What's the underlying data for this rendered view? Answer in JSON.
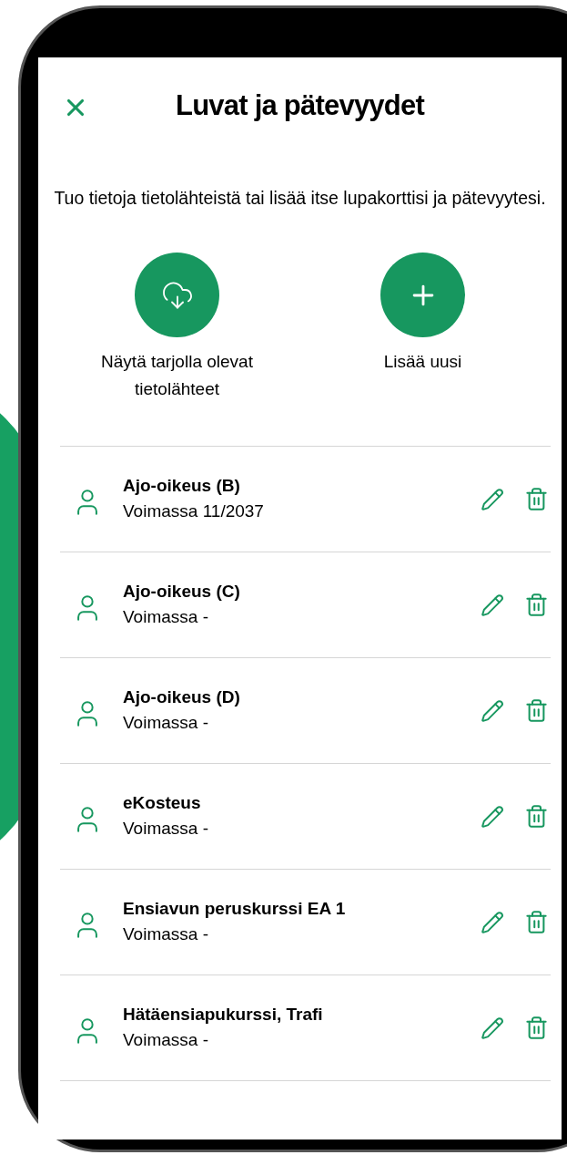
{
  "header": {
    "title": "Luvat ja pätevyydet"
  },
  "intro": "Tuo tietoja tietolähteistä tai lisää itse lupakorttisi ja pätevyytesi.",
  "actions": [
    {
      "kind": "import",
      "label": "Näytä tarjolla olevat tietolähteet"
    },
    {
      "kind": "add",
      "label": "Lisää uusi"
    }
  ],
  "items": [
    {
      "title": "Ajo-oikeus (B)",
      "validity": "Voimassa 11/2037"
    },
    {
      "title": "Ajo-oikeus (C)",
      "validity": "Voimassa -"
    },
    {
      "title": "Ajo-oikeus (D)",
      "validity": "Voimassa -"
    },
    {
      "title": "eKosteus",
      "validity": "Voimassa -"
    },
    {
      "title": "Ensiavun peruskurssi EA 1",
      "validity": "Voimassa -"
    },
    {
      "title": "Hätäensiapukurssi, Trafi",
      "validity": "Voimassa -"
    }
  ]
}
